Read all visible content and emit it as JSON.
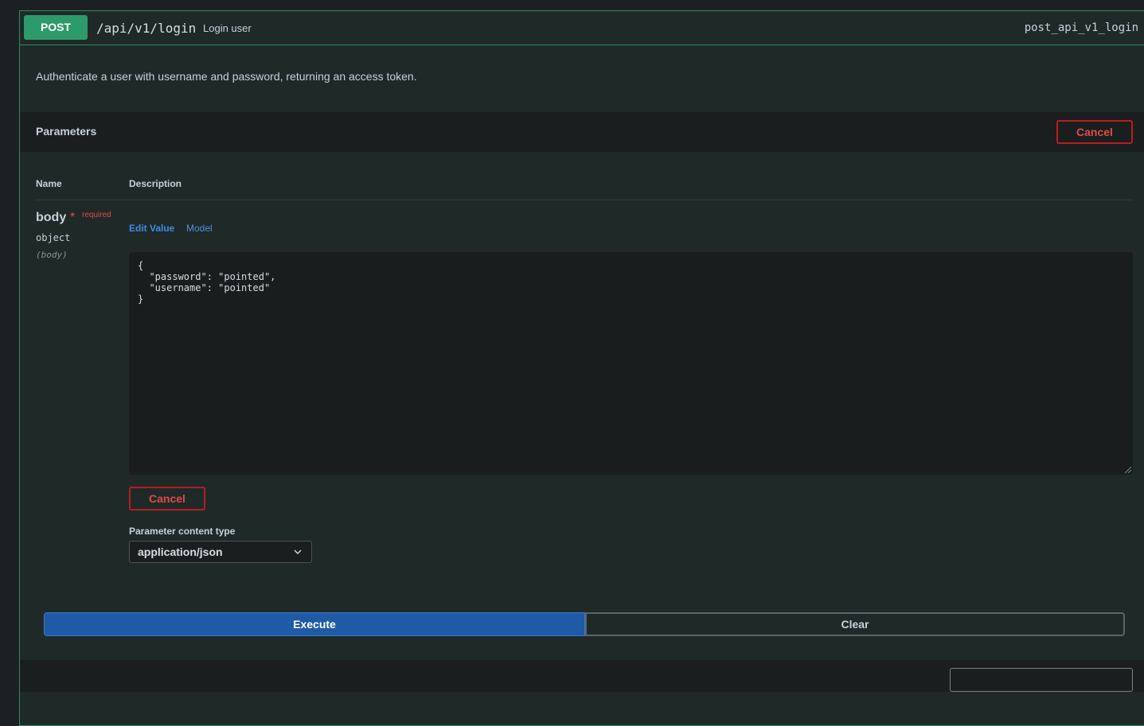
{
  "operation": {
    "method": "POST",
    "path": "/api/v1/login",
    "summary": "Login user",
    "operation_id": "post_api_v1_login",
    "description": "Authenticate a user with username and password, returning an access token."
  },
  "parameters": {
    "title": "Parameters",
    "cancel_label": "Cancel",
    "columns": {
      "name": "Name",
      "description": "Description"
    },
    "body": {
      "name": "body",
      "required_star": "*",
      "required_label": "required",
      "type": "object",
      "in": "(body)",
      "tabs": {
        "edit_value": "Edit Value",
        "model": "Model"
      },
      "value": "{\n  \"password\": \"pointed\",\n  \"username\": \"pointed\"\n}",
      "cancel_label": "Cancel"
    },
    "content_type": {
      "label": "Parameter content type",
      "selected": "application/json"
    }
  },
  "actions": {
    "execute_label": "Execute",
    "clear_label": "Clear"
  },
  "icons": {
    "content_type_chevron": "chevron-down-icon",
    "resize": "resize-grip-icon"
  },
  "colors": {
    "post_accent": "#2d9a6b",
    "execute": "#1f5aa6",
    "cancel": "#e24a4a",
    "link": "#4a90e2"
  }
}
